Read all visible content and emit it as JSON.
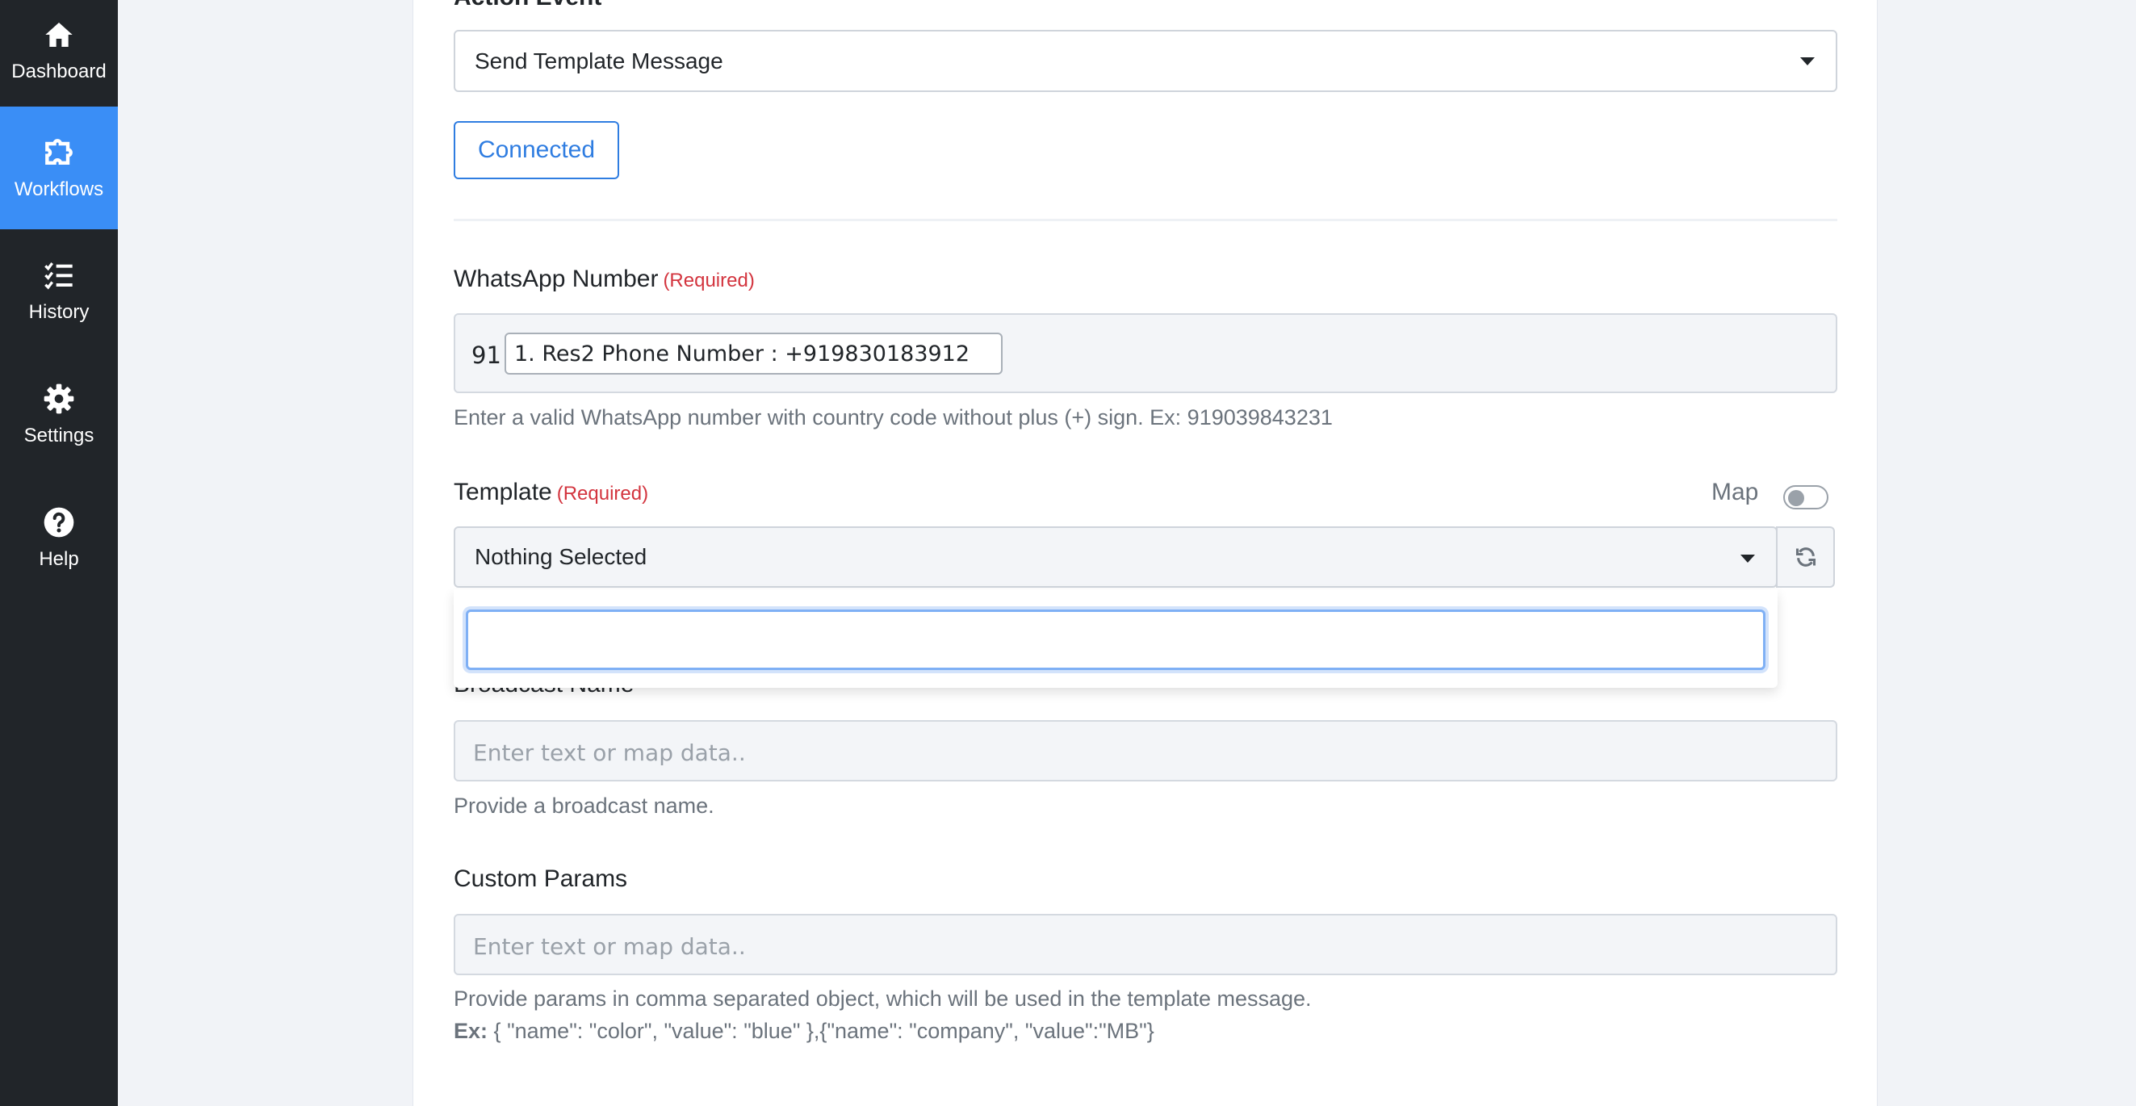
{
  "sidebar": {
    "items": [
      {
        "label": "Dashboard",
        "icon": "home-icon"
      },
      {
        "label": "Workflows",
        "icon": "puzzle-icon"
      },
      {
        "label": "History",
        "icon": "checklist-icon"
      },
      {
        "label": "Settings",
        "icon": "gear-icon"
      },
      {
        "label": "Help",
        "icon": "question-circle-icon"
      }
    ],
    "active": "Workflows"
  },
  "action_event": {
    "label": "Action Event",
    "selected": "Send Template Message"
  },
  "connection": {
    "button_label": "Connected"
  },
  "whatsapp_number": {
    "label": "WhatsApp Number",
    "required": "(Required)",
    "prefix": "91",
    "chip": "1. Res2 Phone Number : +919830183912",
    "help": "Enter a valid WhatsApp number with country code without plus (+) sign. Ex: 919039843231"
  },
  "template": {
    "label": "Template",
    "required": "(Required)",
    "map_label": "Map",
    "map_enabled": false,
    "selected": "Nothing Selected",
    "search_value": ""
  },
  "broadcast_name": {
    "label": "Broadcast Name",
    "placeholder": "Enter text or map data..",
    "help": "Provide a broadcast name."
  },
  "custom_params": {
    "label": "Custom Params",
    "placeholder": "Enter text or map data..",
    "help": "Provide params in comma separated object, which will be used in the template message.",
    "example_prefix": "Ex:",
    "example": "{ \"name\": \"color\", \"value\": \"blue\" },{\"name\": \"company\", \"value\":\"MB\"}"
  },
  "colors": {
    "sidebar_bg": "#212529",
    "active_accent": "#3a8ef6",
    "required_red": "#d3343e",
    "link_blue": "#2f7de1"
  }
}
